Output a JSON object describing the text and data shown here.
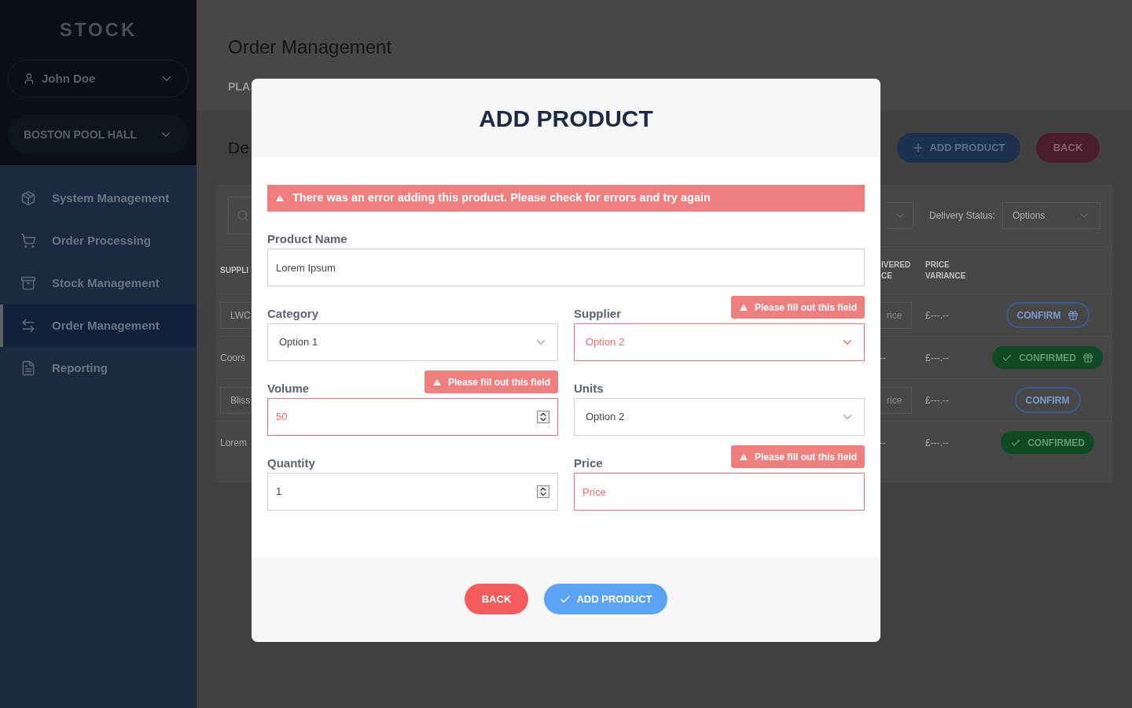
{
  "sidebar": {
    "logo": "STOCK",
    "user": "John Doe",
    "venue": "BOSTON POOL HALL",
    "items": [
      {
        "label": "System Management",
        "selected": false
      },
      {
        "label": "Order Processing",
        "selected": false
      },
      {
        "label": "Stock Management",
        "selected": false
      },
      {
        "label": "Order Management",
        "selected": true
      },
      {
        "label": "Reporting",
        "selected": false
      }
    ]
  },
  "header": {
    "title": "Order Management",
    "tab": "PLA"
  },
  "section": {
    "heading": "De",
    "add_button": "ADD PRODUCT",
    "back_button": "BACK"
  },
  "filters": {
    "status_label": "Delivery Status:",
    "status_value": "Options"
  },
  "table": {
    "first_column": "SUPPLI",
    "right_columns": [
      "IVERED CE",
      "PRICE VARIANCE"
    ],
    "rows": [
      {
        "kind": "input",
        "supplier": "LWC",
        "price": "rice",
        "variance": "£---.--",
        "action": "CONFIRM",
        "confirmed": false,
        "gift": true
      },
      {
        "kind": "text",
        "supplier": "Coors",
        "price": "--",
        "variance": "£---.--",
        "action": "CONFIRMED",
        "confirmed": true,
        "gift": true
      },
      {
        "kind": "input",
        "supplier": "Bliss",
        "price": "rice",
        "variance": "£---.--",
        "action": "CONFIRM",
        "confirmed": false,
        "gift": false
      },
      {
        "kind": "text",
        "supplier": "Lorem",
        "price": "--",
        "variance": "£---.--",
        "action": "CONFIRMED",
        "confirmed": true,
        "gift": false
      }
    ]
  },
  "modal": {
    "title": "ADD PRODUCT",
    "error": "There was an error adding this product. Please check for errors and try again",
    "rows": [
      [
        {
          "kind": "text",
          "label": "Product Name",
          "value": "Lorem Ipsum",
          "error": false
        }
      ],
      [
        {
          "kind": "select",
          "label": "Category",
          "value": "Option 1",
          "error": false
        },
        {
          "kind": "select",
          "label": "Supplier",
          "value": "Option 2",
          "error": true,
          "error_text": "Please fill out this field"
        }
      ],
      [
        {
          "kind": "number",
          "label": "Volume",
          "value": "50",
          "error": true,
          "error_text": "Please fill out this field"
        },
        {
          "kind": "select",
          "label": "Units",
          "value": "Option 2",
          "error": false
        }
      ],
      [
        {
          "kind": "number",
          "label": "Quantity",
          "value": "1",
          "error": false
        },
        {
          "kind": "text",
          "label": "Price",
          "placeholder": "Price",
          "error": true,
          "error_text": "Please fill out this field"
        }
      ]
    ],
    "back_button": "BACK",
    "add_button": "ADD PRODUCT"
  }
}
